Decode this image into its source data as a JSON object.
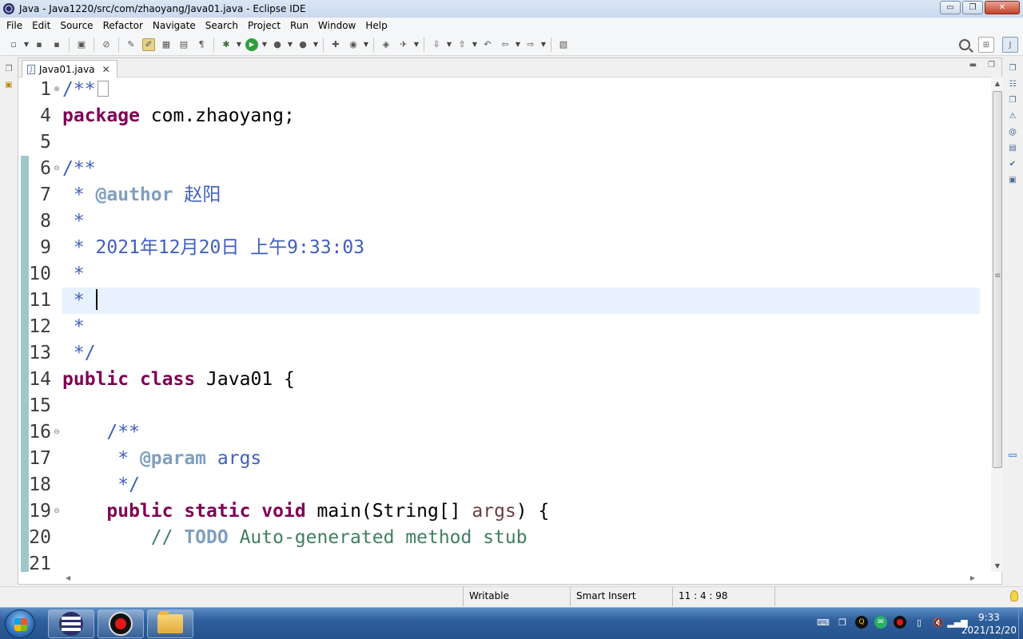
{
  "window": {
    "title": "Java - Java1220/src/com/zhaoyang/Java01.java - Eclipse IDE",
    "minimize": "▭",
    "restore": "❐",
    "close": "✕"
  },
  "menu": [
    "File",
    "Edit",
    "Source",
    "Refactor",
    "Navigate",
    "Search",
    "Project",
    "Run",
    "Window",
    "Help"
  ],
  "editor": {
    "tab_label": "Java01.java",
    "tab_close": "✕",
    "lines": [
      {
        "num": "1",
        "fold": "⊕",
        "segments": [
          {
            "t": "/**",
            "c": "jdoc"
          }
        ],
        "collapsed": true
      },
      {
        "num": "4",
        "segments": [
          {
            "t": "package",
            "c": "kw"
          },
          {
            "t": " com.zhaoyang;",
            "c": "plain"
          }
        ]
      },
      {
        "num": "5",
        "segments": []
      },
      {
        "num": "6",
        "fold": "⊖",
        "segments": [
          {
            "t": "/**",
            "c": "jdoc"
          }
        ]
      },
      {
        "num": "7",
        "segments": [
          {
            "t": " * ",
            "c": "jdoc"
          },
          {
            "t": "@author",
            "c": "tag"
          },
          {
            "t": " 赵阳",
            "c": "jdoc"
          }
        ]
      },
      {
        "num": "8",
        "segments": [
          {
            "t": " *",
            "c": "jdoc"
          }
        ]
      },
      {
        "num": "9",
        "segments": [
          {
            "t": " * 2021年12月20日 上午9:33:03",
            "c": "jdoc"
          }
        ]
      },
      {
        "num": "10",
        "segments": [
          {
            "t": " *",
            "c": "jdoc"
          }
        ]
      },
      {
        "num": "11",
        "segments": [
          {
            "t": " * ",
            "c": "jdoc"
          }
        ],
        "current": true
      },
      {
        "num": "12",
        "segments": [
          {
            "t": " *",
            "c": "jdoc"
          }
        ]
      },
      {
        "num": "13",
        "segments": [
          {
            "t": " */",
            "c": "jdoc"
          }
        ]
      },
      {
        "num": "14",
        "segments": [
          {
            "t": "public",
            "c": "kw"
          },
          {
            "t": " ",
            "c": "plain"
          },
          {
            "t": "class",
            "c": "kw"
          },
          {
            "t": " Java01 {",
            "c": "plain"
          }
        ]
      },
      {
        "num": "15",
        "segments": []
      },
      {
        "num": "16",
        "fold": "⊖",
        "segments": [
          {
            "t": "    /**",
            "c": "jdoc"
          }
        ]
      },
      {
        "num": "17",
        "segments": [
          {
            "t": "     * ",
            "c": "jdoc"
          },
          {
            "t": "@param",
            "c": "tag"
          },
          {
            "t": " args",
            "c": "jdoc"
          }
        ]
      },
      {
        "num": "18",
        "segments": [
          {
            "t": "     */",
            "c": "jdoc"
          }
        ]
      },
      {
        "num": "19",
        "fold": "⊖",
        "segments": [
          {
            "t": "    ",
            "c": "plain"
          },
          {
            "t": "public",
            "c": "kw"
          },
          {
            "t": " ",
            "c": "plain"
          },
          {
            "t": "static",
            "c": "kw"
          },
          {
            "t": " ",
            "c": "plain"
          },
          {
            "t": "void",
            "c": "kw"
          },
          {
            "t": " main(String[] ",
            "c": "plain"
          },
          {
            "t": "args",
            "c": "param"
          },
          {
            "t": ") {",
            "c": "plain"
          }
        ]
      },
      {
        "num": "20",
        "segments": [
          {
            "t": "        // ",
            "c": "cmt"
          },
          {
            "t": "TODO",
            "c": "todo"
          },
          {
            "t": " Auto-generated method stub",
            "c": "cmt"
          }
        ]
      },
      {
        "num": "21",
        "segments": []
      }
    ]
  },
  "status": {
    "writable": "Writable",
    "insert_mode": "Smart Insert",
    "position": "11 : 4 : 98"
  },
  "taskbar": {
    "time": "9:33",
    "date": "2021/12/20"
  },
  "colors": {
    "keyword": "#7f0055",
    "javadoc": "#3f5fbf",
    "javadoc_tag": "#7f9fbf",
    "comment": "#3f7f5f",
    "current_line": "#e8f2fe"
  }
}
